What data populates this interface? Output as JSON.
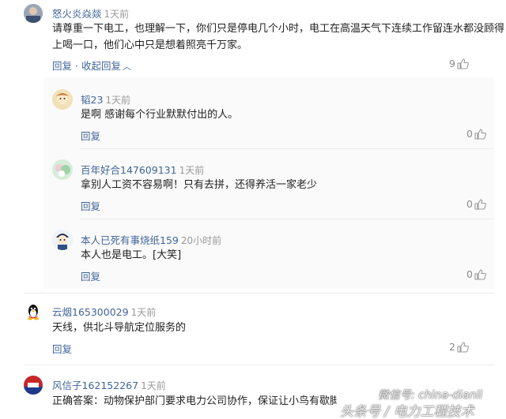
{
  "comments": [
    {
      "user": "怒火炎焱燚",
      "time": "1天前",
      "text_line1": "请尊重一下电工，也理解一下，你们只是停电几个小时，电工在高温天气下连续工作留连水都没顾得",
      "text_line2": "上喝一口，他们心中只是想着照亮千万家。",
      "reply_label": "回复",
      "collapse_label": "收起回复",
      "likes": "9"
    },
    {
      "user": "韬23",
      "time": "1天前",
      "text": "是啊 感谢每个行业默默付出的人。",
      "reply_label": "回复",
      "likes": "0"
    },
    {
      "user": "百年好合147609131",
      "time": "1天前",
      "text": "拿别人工资不容易啊！只有去拼，还得养活一家老少",
      "reply_label": "回复",
      "likes": "0"
    },
    {
      "user": "本人已死有事烧纸159",
      "time": "20小时前",
      "text": "本人也是电工。[大笑]",
      "reply_label": "回复",
      "likes": "0"
    },
    {
      "user": "云烟165300029",
      "time": "1天前",
      "text": "天线，供北斗导航定位服务的",
      "reply_label": "回复",
      "likes": "2"
    },
    {
      "user": "风信子162152267",
      "time": "1天前",
      "text": "正确答案：动物保护部门要求电力公司协作，保证让小鸟有歇脚的安全……"
    }
  ],
  "watermark": {
    "line1": "微信号: china-dianli",
    "line2": "头条号 / 电力工程技术"
  },
  "colors": {
    "link": "#406599",
    "meta": "#999999",
    "text": "#222222"
  }
}
